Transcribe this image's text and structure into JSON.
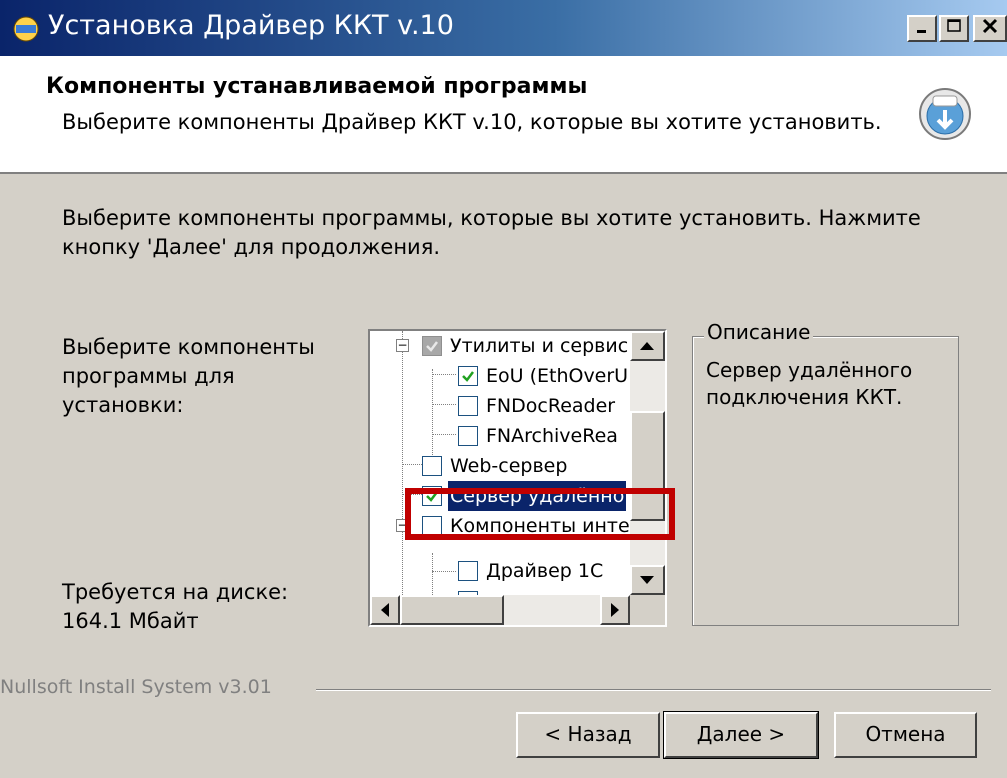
{
  "window": {
    "title": "Установка Драйвер ККТ v.10",
    "icon": "installer-icon",
    "controls": [
      "minimize-icon",
      "maximize-icon",
      "close-icon"
    ]
  },
  "header": {
    "title": "Компоненты устанавливаемой программы",
    "subtitle": "Выберите компоненты Драйвер ККТ v.10, которые вы хотите установить.",
    "logo": "installer-disk-icon"
  },
  "body": {
    "intro": "Выберите компоненты программы, которые вы хотите установить. Нажмите кнопку 'Далее' для продолжения.",
    "select_label": "Выберите компоненты программы для установки:",
    "disk_space": "Требуется на диске: 164.1 Мбайт"
  },
  "tree": {
    "items": [
      {
        "label": "Утилиты и сервис",
        "state": "partial",
        "expander": "−"
      },
      {
        "label": "EoU (EthOverU",
        "state": "checked"
      },
      {
        "label": "FNDocReader",
        "state": "unchecked"
      },
      {
        "label": "FNArchiveRea",
        "state": "unchecked"
      },
      {
        "label": "Web-сервер",
        "state": "unchecked"
      },
      {
        "label": "Сервер удалённо",
        "state": "checked",
        "selected": true
      },
      {
        "label": "Компоненты инте",
        "state": "unchecked",
        "expander": "−"
      },
      {
        "label": "Драйвер 1С",
        "state": "unchecked"
      }
    ]
  },
  "description": {
    "legend": "Описание",
    "text": "Сервер удалённого подключения ККТ."
  },
  "footer": {
    "brand": "Nullsoft Install System v3.01",
    "back_label": "< Назад",
    "next_label": "Далее >",
    "cancel_label": "Отмена"
  },
  "colors": {
    "highlight": "#c00000",
    "selection": "#0a246a",
    "title_bar": "#0a246a"
  }
}
